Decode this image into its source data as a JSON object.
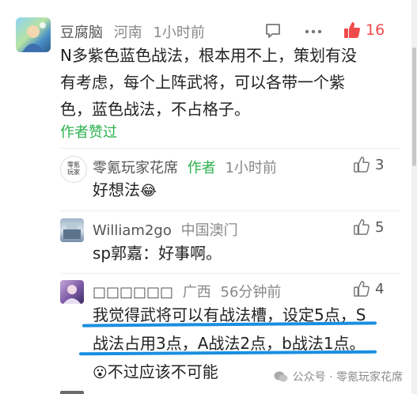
{
  "comment1": {
    "username": "豆腐脑",
    "location": "河南",
    "time": "1小时前",
    "text_line1": "N多紫色蓝色战法，根本用不上，策划有没",
    "text_line2": "有考虑，每个上阵武将，可以各带一个紫",
    "text_line3": "色，蓝色战法，不占格子。",
    "author_liked": "作者赞过",
    "like_count": "16"
  },
  "reply1": {
    "username": "零氪玩家花席",
    "author_tag": "作者",
    "time": "1小时前",
    "avatar_text": "零氪玩家",
    "text": "好想法",
    "emoji": "😂",
    "like_count": "3"
  },
  "reply2": {
    "username": "William2go",
    "location": "中国澳门",
    "text": "sp郭嘉：好事啊。",
    "like_count": "5"
  },
  "reply3": {
    "username": "□□□□□□",
    "location": "广西",
    "time": "56分钟前",
    "text_line1": "我觉得武将可以有战法槽，设定5点，S",
    "text_line2": "战法占用3点，A战法2点，b战法1点。",
    "emoji": "😮",
    "text_line3": "不过应该不可能",
    "like_count": "4"
  },
  "watermark": {
    "text": "公众号 · 零氪玩家花席"
  },
  "colors": {
    "accent_green": "#2bb24c",
    "like_red": "#f04b4b",
    "underline_blue": "#1a8fe0"
  }
}
